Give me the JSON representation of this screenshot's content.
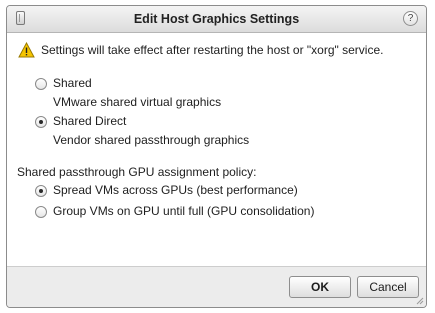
{
  "dialog": {
    "title": "Edit Host Graphics Settings",
    "help_label": "?",
    "warning": "Settings will take effect after restarting the host or \"xorg\" service."
  },
  "graphics_type": {
    "options": [
      {
        "label": "Shared",
        "description": "VMware shared virtual graphics",
        "checked": false
      },
      {
        "label": "Shared Direct",
        "description": "Vendor shared passthrough graphics",
        "checked": true
      }
    ]
  },
  "assignment_policy": {
    "heading": "Shared passthrough GPU assignment policy:",
    "options": [
      {
        "label": "Spread VMs across GPUs (best performance)",
        "checked": true
      },
      {
        "label": "Group VMs on GPU until full (GPU consolidation)",
        "checked": false
      }
    ]
  },
  "buttons": {
    "ok": "OK",
    "cancel": "Cancel"
  },
  "colors": {
    "warning_fill": "#f5c400",
    "titlebar_top": "#f4f4f4",
    "footer_bg": "#ececec"
  },
  "icons": {
    "title": "host-window-icon",
    "warning": "warning-triangle-icon",
    "help": "help-icon"
  }
}
